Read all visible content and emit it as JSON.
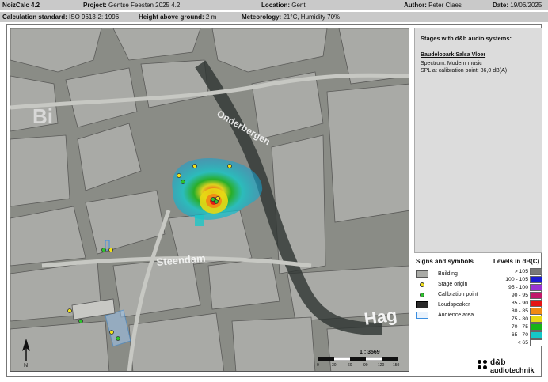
{
  "header": {
    "app": "NoizCalc 4.2",
    "project_label": "Project:",
    "project": "Gentse Feesten 2025 4.2",
    "location_label": "Location:",
    "location": "Gent",
    "author_label": "Author:",
    "author": "Peter Claes",
    "date_label": "Date:",
    "date": "19/06/2025",
    "calc_label": "Calculation standard:",
    "calc": "ISO 9613-2: 1996",
    "height_label": "Height above ground:",
    "height": "2 m",
    "meteo_label": "Meteorology:",
    "meteo": "21°C, Humidity 70%"
  },
  "map": {
    "street_labels": [
      "Bi",
      "Onderbergen",
      "Steendam",
      "Hag"
    ],
    "compass": "N",
    "scale_ratio": "1 : 3569",
    "scale_ticks": [
      "0",
      "30",
      "60",
      "90",
      "120",
      "150"
    ]
  },
  "stages": {
    "title": "Stages with d&b audio systems:",
    "name": "Baudelopark Salsa Vloer",
    "spectrum": "Spectrum:  Modern music",
    "spl": "SPL at calibration point:  86,0 dB(A)"
  },
  "signs": {
    "title": "Signs and symbols",
    "items": [
      "Building",
      "Stage origin",
      "Calibration point",
      "Loudspeaker",
      "Audience area"
    ]
  },
  "levels": {
    "title": "Levels in dB(C)",
    "rows": [
      {
        "label": "> 105",
        "color": "#777777"
      },
      {
        "label": "100 - 105",
        "color": "#1b1bd0"
      },
      {
        "label": "95 - 100",
        "color": "#9a34d2"
      },
      {
        "label": "90 - 95",
        "color": "#c2186a"
      },
      {
        "label": "85 - 90",
        "color": "#e41414"
      },
      {
        "label": "80 - 85",
        "color": "#f08a14"
      },
      {
        "label": "75 - 80",
        "color": "#e8d814"
      },
      {
        "label": "70 - 75",
        "color": "#18b418"
      },
      {
        "label": "65 - 70",
        "color": "#14c8c8"
      },
      {
        "label": "< 65",
        "color": "#ffffff"
      }
    ]
  },
  "logo": {
    "line1": "d&b",
    "line2": "audiotechnik"
  }
}
